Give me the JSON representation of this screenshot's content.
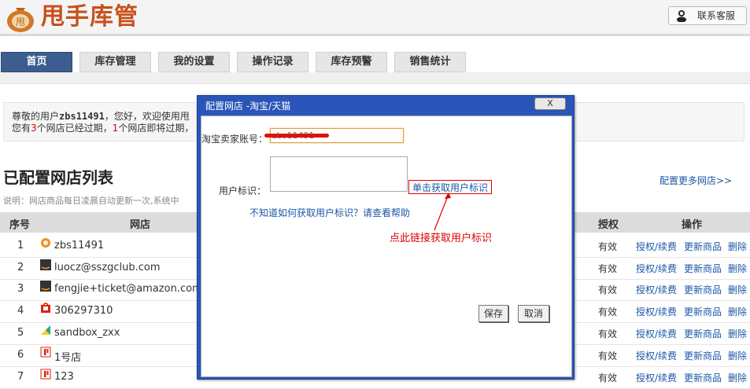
{
  "header": {
    "logo_text": "甩手库管",
    "logo_badge": "甩",
    "contact_label": "联系客服"
  },
  "nav": [
    {
      "label": "首页",
      "active": true
    },
    {
      "label": "库存管理"
    },
    {
      "label": "我的设置"
    },
    {
      "label": "操作记录"
    },
    {
      "label": "库存预警"
    },
    {
      "label": "销售统计"
    }
  ],
  "notice": {
    "l1_pre": "尊敬的用户",
    "username": "zbs11491",
    "l1_post": "，您好，欢迎使用甩",
    "l2_a": "您有",
    "l2_n1": "3",
    "l2_b": "个网店已经过期，",
    "l2_n2": "1",
    "l2_c": "个网店即将过期，"
  },
  "section": {
    "title": "已配置网店列表",
    "desc": "说明：网店商品每日凌晨自动更新一次,系统中",
    "more_link": "配置更多网店>>"
  },
  "table": {
    "headers": {
      "num": "序号",
      "shop": "网店",
      "auth": "授权",
      "action": "操作"
    },
    "rows": [
      {
        "num": "1",
        "shop": "zbs11491",
        "auth": "有效",
        "a1": "授权/续费",
        "a2": "更新商品",
        "a3": "删除"
      },
      {
        "num": "2",
        "shop": "luocz@sszgclub.com",
        "auth": "有效",
        "a1": "授权/续费",
        "a2": "更新商品",
        "a3": "删除"
      },
      {
        "num": "3",
        "shop": "fengjie+ticket@amazon.com",
        "auth": "有效",
        "a1": "授权/续费",
        "a2": "更新商品",
        "a3": "删除"
      },
      {
        "num": "4",
        "shop": "306297310",
        "auth": "有效",
        "a1": "授权/续费",
        "a2": "更新商品",
        "a3": "删除"
      },
      {
        "num": "5",
        "shop": "sandbox_zxx",
        "auth": "有效",
        "a1": "授权/续费",
        "a2": "更新商品",
        "a3": "删除"
      },
      {
        "num": "6",
        "shop": "1号店",
        "auth": "有效",
        "a1": "授权/续费",
        "a2": "更新商品",
        "a3": "删除"
      },
      {
        "num": "7",
        "shop": "123",
        "auth": "有效",
        "a1": "授权/续费",
        "a2": "更新商品",
        "a3": "删除"
      }
    ]
  },
  "dialog": {
    "title": "配置网店 -淘宝/天猫",
    "close_label": "X",
    "account_label": "淘宝卖家账号：",
    "account_value": "zbs11491",
    "ident_label": "用户标识：",
    "get_ident_link": "单击获取用户标识",
    "help_text": "不知道如何获取用户标识？请查看帮助",
    "annotation": "点此链接获取用户标识",
    "save_label": "保存",
    "cancel_label": "取消"
  }
}
